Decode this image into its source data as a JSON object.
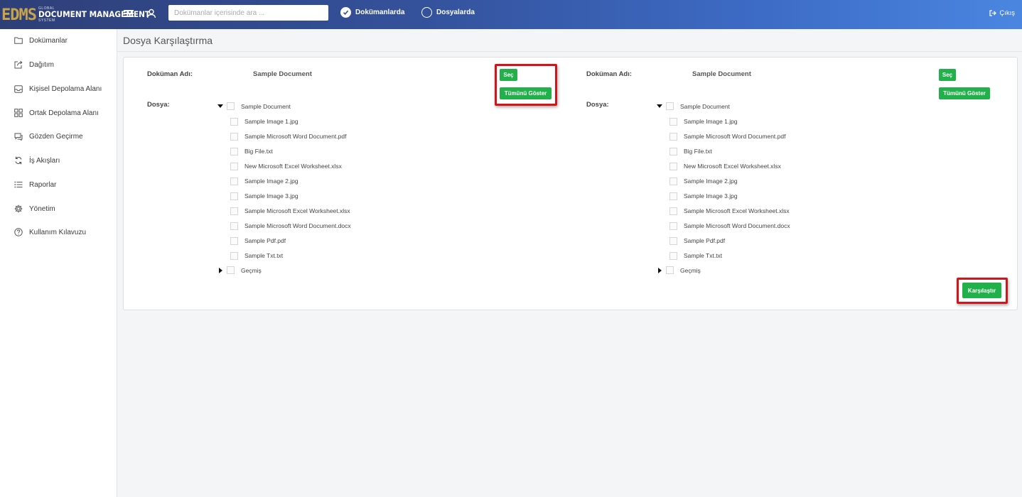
{
  "app": {
    "logo_edms": "EDMS",
    "logo_global": "GLOBAL",
    "logo_main": "DOCUMENT MANAGEMENT",
    "logo_system": "SYSTEM",
    "search_placeholder": "Dokümanlar içerisinde ara ...",
    "search_scope": [
      {
        "label": "Dokümanlarda",
        "checked": true
      },
      {
        "label": "Dosyalarda",
        "checked": false
      }
    ],
    "logout_label": "Çıkış"
  },
  "sidebar": {
    "items": [
      {
        "label": "Dokümanlar",
        "icon": "folder-icon"
      },
      {
        "label": "Dağıtım",
        "icon": "share-icon"
      },
      {
        "label": "Kişisel Depolama Alanı",
        "icon": "inbox-icon"
      },
      {
        "label": "Ortak Depolama Alanı",
        "icon": "grid-icon"
      },
      {
        "label": "Gözden Geçirme",
        "icon": "chat-icon"
      },
      {
        "label": "İş Akışları",
        "icon": "refresh-icon"
      },
      {
        "label": "Raporlar",
        "icon": "list-icon"
      },
      {
        "label": "Yönetim",
        "icon": "gear-icon"
      },
      {
        "label": "Kullanım Kılavuzu",
        "icon": "help-icon"
      }
    ]
  },
  "page": {
    "title": "Dosya Karşılaştırma",
    "compare_button": "Karşılaştır"
  },
  "panels": [
    {
      "doc_label": "Doküman Adı:",
      "doc_name": "Sample Document",
      "file_label": "Dosya:",
      "select_button": "Seç",
      "show_all_button": "Tümünü Göster",
      "tree_root": "Sample Document",
      "files": [
        "Sample Image 1.jpg",
        "Sample Microsoft Word Document.pdf",
        "Big File.txt",
        "New Microsoft Excel Worksheet.xlsx",
        "Sample Image 2.jpg",
        "Sample Image 3.jpg",
        "Sample Microsoft Excel Worksheet.xlsx",
        "Sample Microsoft Word Document.docx",
        "Sample Pdf.pdf",
        "Sample Txt.txt"
      ],
      "history_node": "Geçmiş"
    },
    {
      "doc_label": "Doküman Adı:",
      "doc_name": "Sample Document",
      "file_label": "Dosya:",
      "select_button": "Seç",
      "show_all_button": "Tümünü Göster",
      "tree_root": "Sample Document",
      "files": [
        "Sample Image 1.jpg",
        "Sample Microsoft Word Document.pdf",
        "Big File.txt",
        "New Microsoft Excel Worksheet.xlsx",
        "Sample Image 2.jpg",
        "Sample Image 3.jpg",
        "Sample Microsoft Excel Worksheet.xlsx",
        "Sample Microsoft Word Document.docx",
        "Sample Pdf.pdf",
        "Sample Txt.txt"
      ],
      "history_node": "Geçmiş"
    }
  ],
  "colors": {
    "accent_green": "#22b04b",
    "highlight_red": "#d0161b",
    "topbar_start": "#2e3f78",
    "topbar_end": "#4a86e0"
  }
}
